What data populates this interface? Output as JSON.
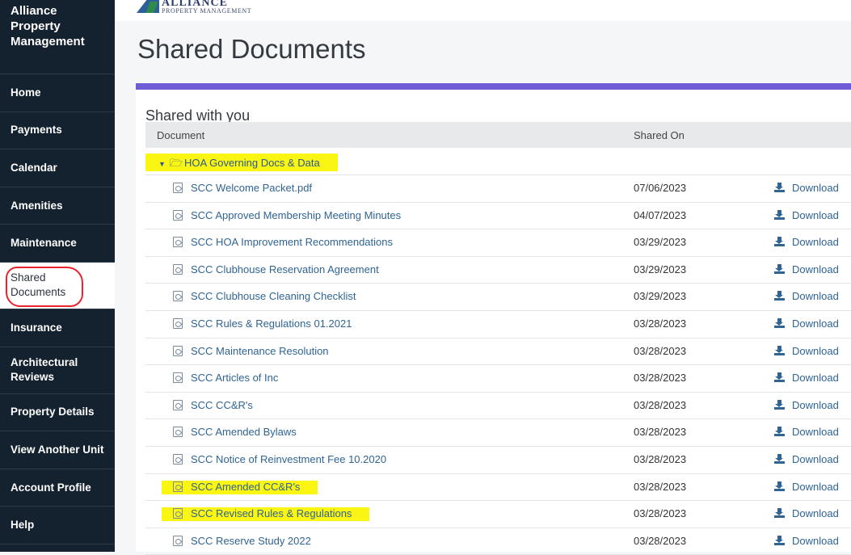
{
  "brand": {
    "line1": "Alliance",
    "line2": "Property",
    "line3": "Management"
  },
  "logo": {
    "top": "ALLIANCE",
    "sub": "PROPERTY MANAGEMENT"
  },
  "nav": [
    {
      "label": "Home"
    },
    {
      "label": "Payments"
    },
    {
      "label": "Calendar"
    },
    {
      "label": "Amenities"
    },
    {
      "label": "Maintenance"
    },
    {
      "label": "Shared Documents",
      "line1": "Shared",
      "line2": "Documents",
      "active": true
    },
    {
      "label": "Insurance"
    },
    {
      "label": "Architectural Reviews",
      "line1": "Architectural",
      "line2": "Reviews"
    },
    {
      "label": "Property Details"
    },
    {
      "label": "View Another Unit"
    },
    {
      "label": "Account Profile"
    },
    {
      "label": "Help"
    }
  ],
  "page": {
    "title": "Shared Documents"
  },
  "panel": {
    "heading": "Shared with you"
  },
  "table": {
    "headers": {
      "document": "Document",
      "shared_on": "Shared On"
    },
    "folder": {
      "name": "HOA Governing Docs & Data",
      "highlighted": true
    },
    "download_label": "Download",
    "rows": [
      {
        "name": "SCC Welcome Packet.pdf",
        "date": "07/06/2023"
      },
      {
        "name": "SCC Approved Membership Meeting Minutes",
        "date": "04/07/2023"
      },
      {
        "name": "SCC HOA Improvement Recommendations",
        "date": "03/29/2023"
      },
      {
        "name": "SCC Clubhouse Reservation Agreement",
        "date": "03/29/2023"
      },
      {
        "name": "SCC Clubhouse Cleaning Checklist",
        "date": "03/29/2023"
      },
      {
        "name": "SCC Rules & Regulations 01.2021",
        "date": "03/28/2023"
      },
      {
        "name": "SCC Maintenance Resolution",
        "date": "03/28/2023"
      },
      {
        "name": "SCC Articles of Inc",
        "date": "03/28/2023"
      },
      {
        "name": "SCC CC&R's",
        "date": "03/28/2023"
      },
      {
        "name": "SCC Amended Bylaws",
        "date": "03/28/2023"
      },
      {
        "name": "SCC Notice of Reinvestment Fee 10.2020",
        "date": "03/28/2023"
      },
      {
        "name": "SCC Amended CC&R's",
        "date": "03/28/2023",
        "highlighted": true
      },
      {
        "name": "SCC Revised Rules & Regulations",
        "date": "03/28/2023",
        "highlighted": true
      },
      {
        "name": "SCC Reserve Study 2022",
        "date": "03/28/2023"
      }
    ]
  },
  "colors": {
    "sidebar": "#14212e",
    "accent": "#6f5bd6",
    "highlight": "#fbf514",
    "link": "#2f6493",
    "annotation": "#e8252c"
  }
}
